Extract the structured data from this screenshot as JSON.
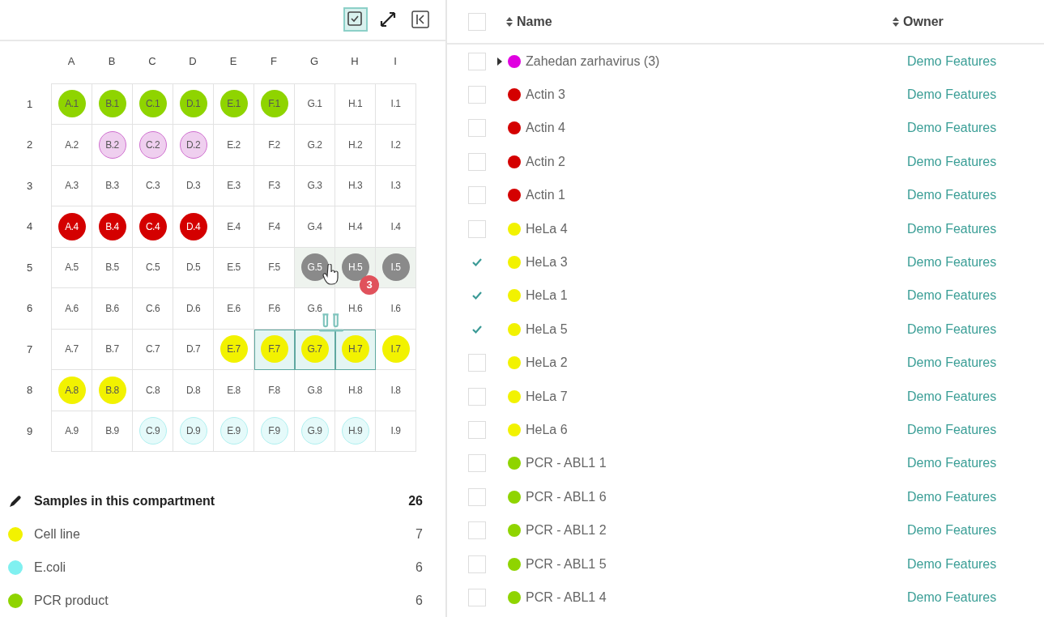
{
  "toolbar": [
    {
      "kind": "select-mode",
      "selected": true
    },
    {
      "kind": "expand",
      "selected": false
    },
    {
      "kind": "collapse",
      "selected": false
    }
  ],
  "plate": {
    "columns": [
      "A",
      "B",
      "C",
      "D",
      "E",
      "F",
      "G",
      "H",
      "I"
    ],
    "rows": [
      {
        "label": "1",
        "wells": [
          {
            "label": "A.1",
            "kind": "solid",
            "color": "#8fd400",
            "selected": false
          },
          {
            "label": "B.1",
            "kind": "solid",
            "color": "#8fd400",
            "selected": false
          },
          {
            "label": "C.1",
            "kind": "solid",
            "color": "#8fd400",
            "selected": false
          },
          {
            "label": "D.1",
            "kind": "solid",
            "color": "#8fd400",
            "selected": false
          },
          {
            "label": "E.1",
            "kind": "solid",
            "color": "#8fd400",
            "selected": false
          },
          {
            "label": "F.1",
            "kind": "solid",
            "color": "#8fd400",
            "selected": false
          },
          {
            "label": "G.1",
            "kind": "plain",
            "selected": false
          },
          {
            "label": "H.1",
            "kind": "plain",
            "selected": false
          },
          {
            "label": "I.1",
            "kind": "plain",
            "selected": false
          }
        ]
      },
      {
        "label": "2",
        "wells": [
          {
            "label": "A.2",
            "kind": "plain",
            "selected": false
          },
          {
            "label": "B.2",
            "kind": "ring",
            "color": "#d070d0",
            "selected": false
          },
          {
            "label": "C.2",
            "kind": "ring",
            "color": "#d070d0",
            "selected": false
          },
          {
            "label": "D.2",
            "kind": "ring",
            "color": "#d070d0",
            "selected": false
          },
          {
            "label": "E.2",
            "kind": "plain",
            "selected": false
          },
          {
            "label": "F.2",
            "kind": "plain",
            "selected": false
          },
          {
            "label": "G.2",
            "kind": "plain",
            "selected": false
          },
          {
            "label": "H.2",
            "kind": "plain",
            "selected": false
          },
          {
            "label": "I.2",
            "kind": "plain",
            "selected": false
          }
        ]
      },
      {
        "label": "3",
        "wells": [
          {
            "label": "A.3",
            "kind": "plain",
            "selected": false
          },
          {
            "label": "B.3",
            "kind": "plain",
            "selected": false
          },
          {
            "label": "C.3",
            "kind": "plain",
            "selected": false
          },
          {
            "label": "D.3",
            "kind": "plain",
            "selected": false
          },
          {
            "label": "E.3",
            "kind": "plain",
            "selected": false
          },
          {
            "label": "F.3",
            "kind": "plain",
            "selected": false
          },
          {
            "label": "G.3",
            "kind": "plain",
            "selected": false
          },
          {
            "label": "H.3",
            "kind": "plain",
            "selected": false
          },
          {
            "label": "I.3",
            "kind": "plain",
            "selected": false
          }
        ]
      },
      {
        "label": "4",
        "wells": [
          {
            "label": "A.4",
            "kind": "solid",
            "color": "#d40000",
            "selected": false
          },
          {
            "label": "B.4",
            "kind": "solid",
            "color": "#d40000",
            "selected": false
          },
          {
            "label": "C.4",
            "kind": "solid",
            "color": "#d40000",
            "selected": false
          },
          {
            "label": "D.4",
            "kind": "solid",
            "color": "#d40000",
            "selected": false
          },
          {
            "label": "E.4",
            "kind": "plain",
            "selected": false
          },
          {
            "label": "F.4",
            "kind": "plain",
            "selected": false
          },
          {
            "label": "G.4",
            "kind": "plain",
            "selected": false
          },
          {
            "label": "H.4",
            "kind": "plain",
            "selected": false
          },
          {
            "label": "I.4",
            "kind": "plain",
            "selected": false
          }
        ]
      },
      {
        "label": "5",
        "wells": [
          {
            "label": "A.5",
            "kind": "plain",
            "selected": false
          },
          {
            "label": "B.5",
            "kind": "plain",
            "selected": false
          },
          {
            "label": "C.5",
            "kind": "plain",
            "selected": false
          },
          {
            "label": "D.5",
            "kind": "plain",
            "selected": false
          },
          {
            "label": "E.5",
            "kind": "plain",
            "selected": false
          },
          {
            "label": "F.5",
            "kind": "plain",
            "selected": false
          },
          {
            "label": "G.5",
            "kind": "solid",
            "color": "#8a8a8a",
            "selected": false
          },
          {
            "label": "H.5",
            "kind": "solid",
            "color": "#8a8a8a",
            "selected": false
          },
          {
            "label": "I.5",
            "kind": "solid",
            "color": "#8a8a8a",
            "selected": false
          }
        ]
      },
      {
        "label": "6",
        "wells": [
          {
            "label": "A.6",
            "kind": "plain",
            "selected": false
          },
          {
            "label": "B.6",
            "kind": "plain",
            "selected": false
          },
          {
            "label": "C.6",
            "kind": "plain",
            "selected": false
          },
          {
            "label": "D.6",
            "kind": "plain",
            "selected": false
          },
          {
            "label": "E.6",
            "kind": "plain",
            "selected": false
          },
          {
            "label": "F.6",
            "kind": "plain",
            "selected": false
          },
          {
            "label": "G.6",
            "kind": "plain",
            "selected": false
          },
          {
            "label": "H.6",
            "kind": "plain",
            "selected": false
          },
          {
            "label": "I.6",
            "kind": "plain",
            "selected": false
          }
        ]
      },
      {
        "label": "7",
        "wells": [
          {
            "label": "A.7",
            "kind": "plain",
            "selected": false
          },
          {
            "label": "B.7",
            "kind": "plain",
            "selected": false
          },
          {
            "label": "C.7",
            "kind": "plain",
            "selected": false
          },
          {
            "label": "D.7",
            "kind": "plain",
            "selected": false
          },
          {
            "label": "E.7",
            "kind": "solid",
            "color": "#f2f200",
            "selected": false
          },
          {
            "label": "F.7",
            "kind": "solid",
            "color": "#f2f200",
            "selected": true
          },
          {
            "label": "G.7",
            "kind": "solid",
            "color": "#f2f200",
            "selected": true
          },
          {
            "label": "H.7",
            "kind": "solid",
            "color": "#f2f200",
            "selected": true
          },
          {
            "label": "I.7",
            "kind": "solid",
            "color": "#f2f200",
            "selected": false
          }
        ]
      },
      {
        "label": "8",
        "wells": [
          {
            "label": "A.8",
            "kind": "solid",
            "color": "#f2f200",
            "selected": false
          },
          {
            "label": "B.8",
            "kind": "solid",
            "color": "#f2f200",
            "selected": false
          },
          {
            "label": "C.8",
            "kind": "plain",
            "selected": false
          },
          {
            "label": "D.8",
            "kind": "plain",
            "selected": false
          },
          {
            "label": "E.8",
            "kind": "plain",
            "selected": false
          },
          {
            "label": "F.8",
            "kind": "plain",
            "selected": false
          },
          {
            "label": "G.8",
            "kind": "plain",
            "selected": false
          },
          {
            "label": "H.8",
            "kind": "plain",
            "selected": false
          },
          {
            "label": "I.8",
            "kind": "plain",
            "selected": false
          }
        ]
      },
      {
        "label": "9",
        "wells": [
          {
            "label": "A.9",
            "kind": "plain",
            "selected": false
          },
          {
            "label": "B.9",
            "kind": "plain",
            "selected": false
          },
          {
            "label": "C.9",
            "kind": "ring",
            "color": "#b0f0f0",
            "selected": false
          },
          {
            "label": "D.9",
            "kind": "ring",
            "color": "#b0f0f0",
            "selected": false
          },
          {
            "label": "E.9",
            "kind": "ring",
            "color": "#b0f0f0",
            "selected": false
          },
          {
            "label": "F.9",
            "kind": "ring",
            "color": "#b0f0f0",
            "selected": false
          },
          {
            "label": "G.9",
            "kind": "ring",
            "color": "#b0f0f0",
            "selected": false
          },
          {
            "label": "H.9",
            "kind": "ring",
            "color": "#b0f0f0",
            "selected": false
          },
          {
            "label": "I.9",
            "kind": "plain",
            "selected": false
          }
        ]
      }
    ],
    "drag_badge": "3"
  },
  "legend": {
    "title": "Samples in this compartment",
    "total": "26",
    "items": [
      {
        "name": "Cell line",
        "count": "7",
        "color": "#f2f200"
      },
      {
        "name": "E.coli",
        "count": "6",
        "color": "#80f0f0"
      },
      {
        "name": "PCR product",
        "count": "6",
        "color": "#8fd400"
      }
    ]
  },
  "table": {
    "select_all": {
      "checked": false
    },
    "columns": [
      "Name",
      "Owner"
    ],
    "rows": [
      {
        "kind": "group",
        "expanded": false,
        "checked": false,
        "color": "#e000e0",
        "name": "Zahedan zarhavirus (3)",
        "owner": "Demo Features"
      },
      {
        "kind": "sample",
        "checked": false,
        "color": "#d40000",
        "name": "Actin 3",
        "owner": "Demo Features"
      },
      {
        "kind": "sample",
        "checked": false,
        "color": "#d40000",
        "name": "Actin 4",
        "owner": "Demo Features"
      },
      {
        "kind": "sample",
        "checked": false,
        "color": "#d40000",
        "name": "Actin 2",
        "owner": "Demo Features"
      },
      {
        "kind": "sample",
        "checked": false,
        "color": "#d40000",
        "name": "Actin 1",
        "owner": "Demo Features"
      },
      {
        "kind": "sample",
        "checked": false,
        "color": "#f2f200",
        "name": "HeLa 4",
        "owner": "Demo Features"
      },
      {
        "kind": "sample",
        "checked": true,
        "color": "#f2f200",
        "name": "HeLa 3",
        "owner": "Demo Features"
      },
      {
        "kind": "sample",
        "checked": true,
        "color": "#f2f200",
        "name": "HeLa 1",
        "owner": "Demo Features"
      },
      {
        "kind": "sample",
        "checked": true,
        "color": "#f2f200",
        "name": "HeLa 5",
        "owner": "Demo Features"
      },
      {
        "kind": "sample",
        "checked": false,
        "color": "#f2f200",
        "name": "HeLa 2",
        "owner": "Demo Features"
      },
      {
        "kind": "sample",
        "checked": false,
        "color": "#f2f200",
        "name": "HeLa 7",
        "owner": "Demo Features"
      },
      {
        "kind": "sample",
        "checked": false,
        "color": "#f2f200",
        "name": "HeLa 6",
        "owner": "Demo Features"
      },
      {
        "kind": "sample",
        "checked": false,
        "color": "#8fd400",
        "name": "PCR - ABL1 1",
        "owner": "Demo Features"
      },
      {
        "kind": "sample",
        "checked": false,
        "color": "#8fd400",
        "name": "PCR - ABL1 6",
        "owner": "Demo Features"
      },
      {
        "kind": "sample",
        "checked": false,
        "color": "#8fd400",
        "name": "PCR - ABL1 2",
        "owner": "Demo Features"
      },
      {
        "kind": "sample",
        "checked": false,
        "color": "#8fd400",
        "name": "PCR - ABL1 5",
        "owner": "Demo Features"
      },
      {
        "kind": "sample",
        "checked": false,
        "color": "#8fd400",
        "name": "PCR - ABL1 4",
        "owner": "Demo Features"
      }
    ]
  }
}
